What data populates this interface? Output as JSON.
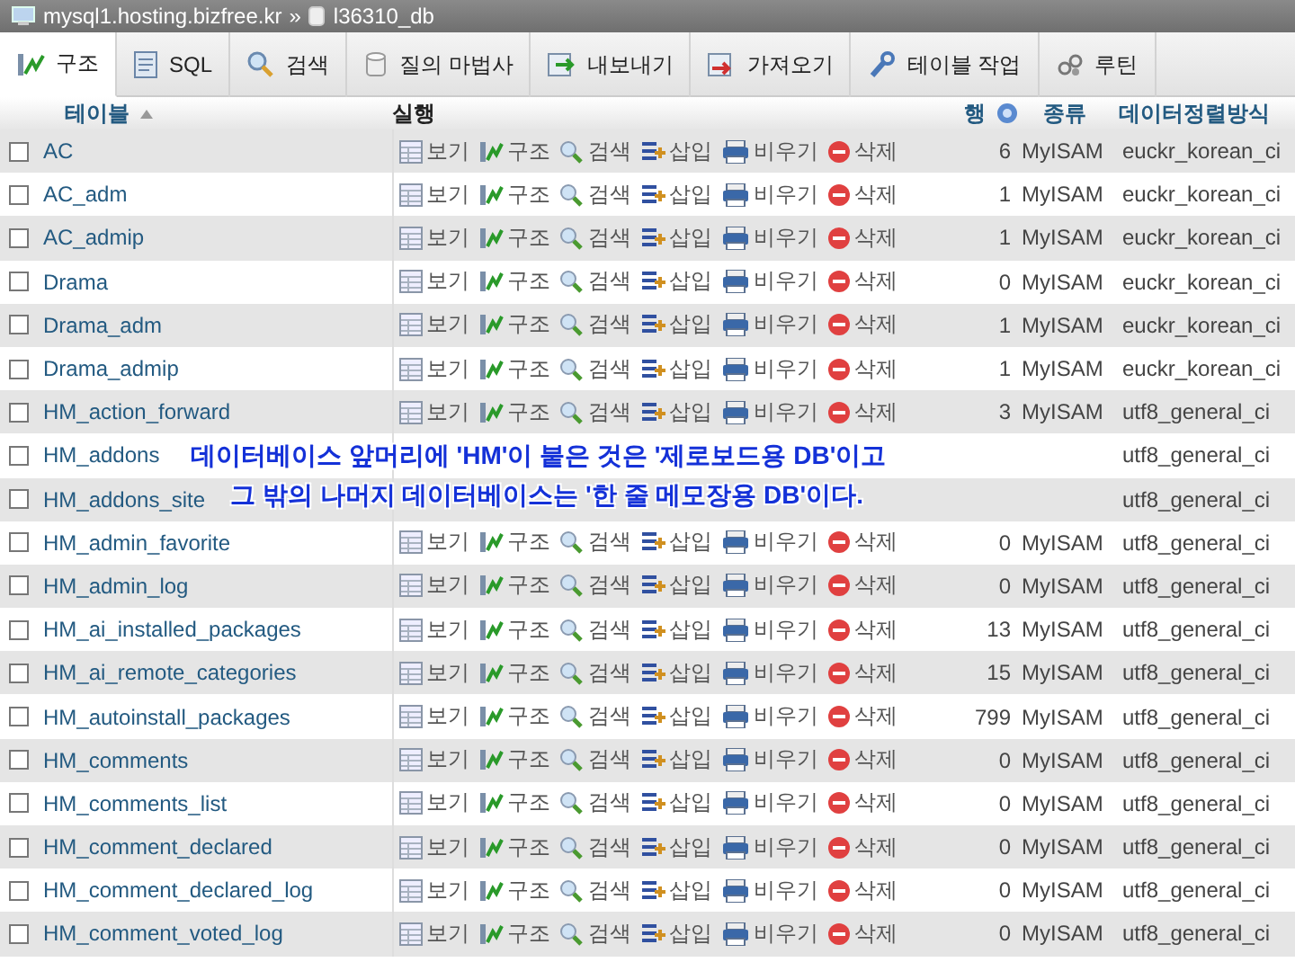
{
  "breadcrumb": {
    "server": "mysql1.hosting.bizfree.kr",
    "separator": "»",
    "database": "l36310_db"
  },
  "tabs": [
    {
      "label": "구조",
      "selected": true
    },
    {
      "label": "SQL",
      "selected": false
    },
    {
      "label": "검색",
      "selected": false
    },
    {
      "label": "질의 마법사",
      "selected": false
    },
    {
      "label": "내보내기",
      "selected": false
    },
    {
      "label": "가져오기",
      "selected": false
    },
    {
      "label": "테이블 작업",
      "selected": false
    },
    {
      "label": "루틴",
      "selected": false
    }
  ],
  "columns": {
    "table": "테이블",
    "action": "실행",
    "rows": "행",
    "engine": "종류",
    "collation": "데이터정렬방식"
  },
  "rows": [
    {
      "name": "AC",
      "checked": false,
      "actions": [
        "보기",
        "구조",
        "검색",
        "삽입",
        "비우기",
        "삭제"
      ],
      "rows": "6",
      "engine": "MyISAM",
      "collation": "euckr_korean_ci"
    },
    {
      "name": "AC_adm",
      "checked": false,
      "actions": [
        "보기",
        "구조",
        "검색",
        "삽입",
        "비우기",
        "삭제"
      ],
      "rows": "1",
      "engine": "MyISAM",
      "collation": "euckr_korean_ci"
    },
    {
      "name": "AC_admip",
      "checked": false,
      "actions": [
        "보기",
        "구조",
        "검색",
        "삽입",
        "비우기",
        "삭제"
      ],
      "rows": "1",
      "engine": "MyISAM",
      "collation": "euckr_korean_ci"
    },
    {
      "name": "Drama",
      "checked": false,
      "actions": [
        "보기",
        "구조",
        "검색",
        "삽입",
        "비우기",
        "삭제"
      ],
      "rows": "0",
      "engine": "MyISAM",
      "collation": "euckr_korean_ci"
    },
    {
      "name": "Drama_adm",
      "checked": false,
      "actions": [
        "보기",
        "구조",
        "검색",
        "삽입",
        "비우기",
        "삭제"
      ],
      "rows": "1",
      "engine": "MyISAM",
      "collation": "euckr_korean_ci"
    },
    {
      "name": "Drama_admip",
      "checked": false,
      "actions": [
        "보기",
        "구조",
        "검색",
        "삽입",
        "비우기",
        "삭제"
      ],
      "rows": "1",
      "engine": "MyISAM",
      "collation": "euckr_korean_ci"
    },
    {
      "name": "HM_action_forward",
      "checked": false,
      "actions": [
        "보기",
        "구조",
        "검색",
        "삽입",
        "비우기",
        "삭제"
      ],
      "rows": "3",
      "engine": "MyISAM",
      "collation": "utf8_general_ci"
    },
    {
      "name": "HM_addons",
      "checked": false,
      "collation": "utf8_general_ci"
    },
    {
      "name": "HM_addons_site",
      "checked": false,
      "collation": "utf8_general_ci"
    },
    {
      "name": "HM_admin_favorite",
      "checked": false,
      "actions": [
        "보기",
        "구조",
        "검색",
        "삽입",
        "비우기",
        "삭제"
      ],
      "rows": "0",
      "engine": "MyISAM",
      "collation": "utf8_general_ci"
    },
    {
      "name": "HM_admin_log",
      "checked": false,
      "actions": [
        "보기",
        "구조",
        "검색",
        "삽입",
        "비우기",
        "삭제"
      ],
      "rows": "0",
      "engine": "MyISAM",
      "collation": "utf8_general_ci"
    },
    {
      "name": "HM_ai_installed_packages",
      "checked": false,
      "actions": [
        "보기",
        "구조",
        "검색",
        "삽입",
        "비우기",
        "삭제"
      ],
      "rows": "13",
      "engine": "MyISAM",
      "collation": "utf8_general_ci"
    },
    {
      "name": "HM_ai_remote_categories",
      "checked": false,
      "actions": [
        "보기",
        "구조",
        "검색",
        "삽입",
        "비우기",
        "삭제"
      ],
      "rows": "15",
      "engine": "MyISAM",
      "collation": "utf8_general_ci"
    },
    {
      "name": "HM_autoinstall_packages",
      "checked": false,
      "actions": [
        "보기",
        "구조",
        "검색",
        "삽입",
        "비우기",
        "삭제"
      ],
      "rows": "799",
      "engine": "MyISAM",
      "collation": "utf8_general_ci"
    },
    {
      "name": "HM_comments",
      "checked": false,
      "actions": [
        "보기",
        "구조",
        "검색",
        "삽입",
        "비우기",
        "삭제"
      ],
      "rows": "0",
      "engine": "MyISAM",
      "collation": "utf8_general_ci"
    },
    {
      "name": "HM_comments_list",
      "checked": false,
      "actions": [
        "보기",
        "구조",
        "검색",
        "삽입",
        "비우기",
        "삭제"
      ],
      "rows": "0",
      "engine": "MyISAM",
      "collation": "utf8_general_ci"
    },
    {
      "name": "HM_comment_declared",
      "checked": false,
      "actions": [
        "보기",
        "구조",
        "검색",
        "삽입",
        "비우기",
        "삭제"
      ],
      "rows": "0",
      "engine": "MyISAM",
      "collation": "utf8_general_ci"
    },
    {
      "name": "HM_comment_declared_log",
      "checked": false,
      "actions": [
        "보기",
        "구조",
        "검색",
        "삽입",
        "비우기",
        "삭제"
      ],
      "rows": "0",
      "engine": "MyISAM",
      "collation": "utf8_general_ci"
    },
    {
      "name": "HM_comment_voted_log",
      "checked": false,
      "actions": [
        "보기",
        "구조",
        "검색",
        "삽입",
        "비우기",
        "삭제"
      ],
      "rows": "0",
      "engine": "MyISAM",
      "collation": "utf8_general_ci"
    }
  ],
  "annotation": [
    "데이터베이스 앞머리에 'HM'이 붙은 것은 '제로보드용 DB'이고",
    "그 밖의 나머지 데이터베이스는 '한 줄 메모장용 DB'이다."
  ]
}
